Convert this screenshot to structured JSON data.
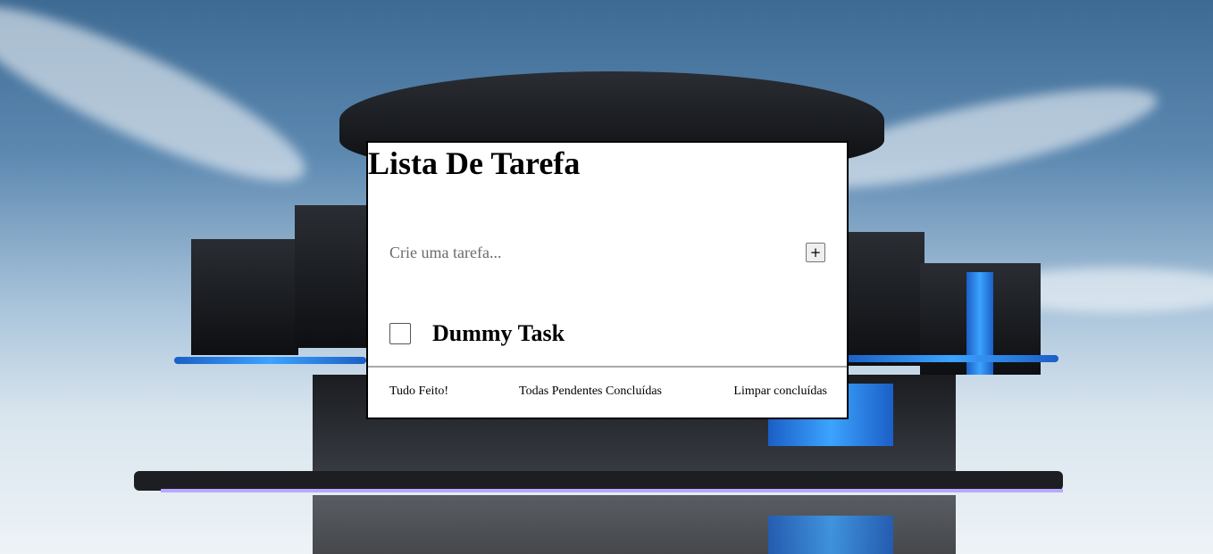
{
  "app": {
    "title": "Lista De Tarefa"
  },
  "new_task": {
    "placeholder": "Crie uma tarefa...",
    "value": "",
    "add_label": "+"
  },
  "tasks": [
    {
      "label": "Dummy Task",
      "completed": false
    }
  ],
  "footer": {
    "all_done_label": "Tudo Feito!",
    "all_pending_done_label": "Todas Pendentes Concluídas",
    "clear_done_label": "Limpar concluídas"
  },
  "colors": {
    "card_background": "#ffffff",
    "card_border": "#000000",
    "divider": "#a9a9a9"
  }
}
